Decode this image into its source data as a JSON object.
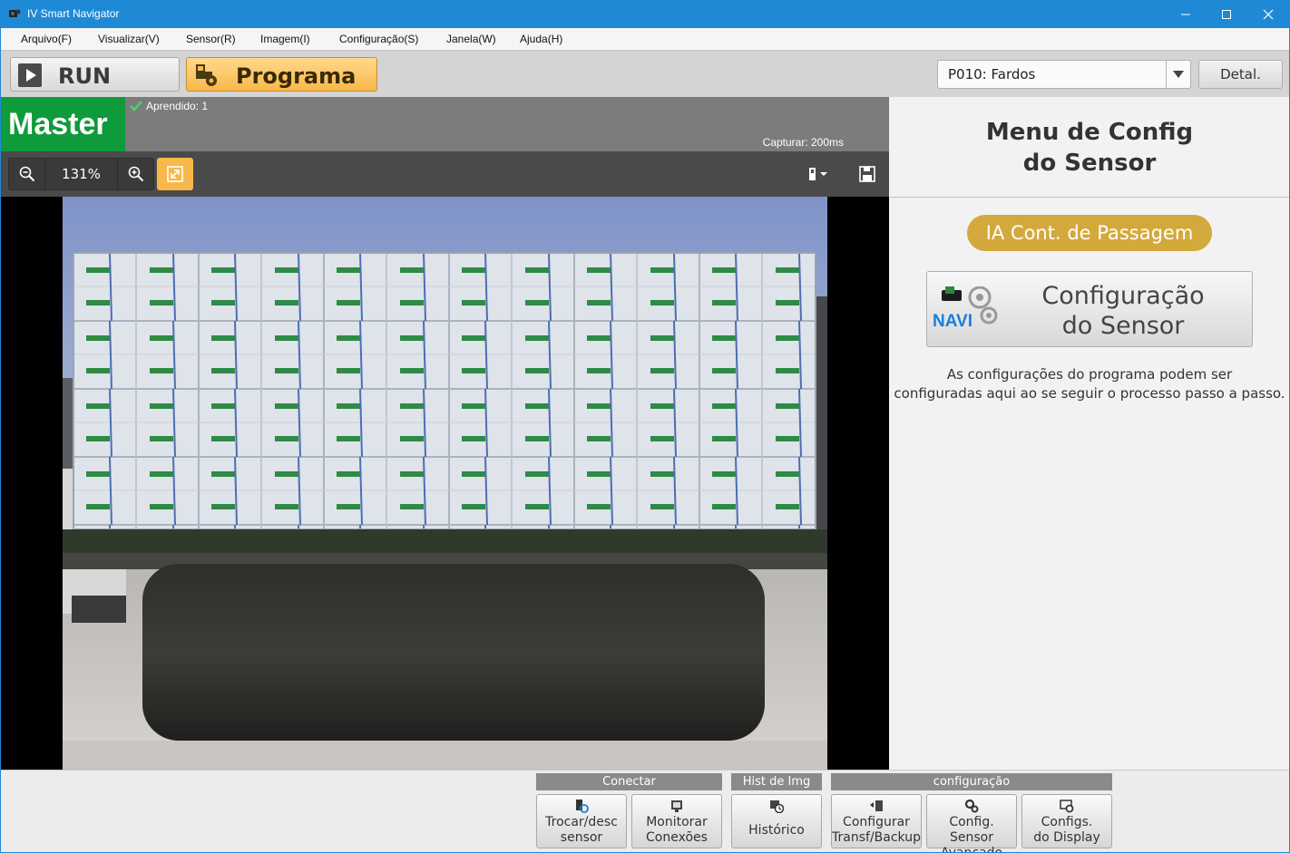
{
  "window": {
    "title": "IV Smart Navigator",
    "icons": {
      "app": "camera-icon",
      "minimize": "minimize-icon",
      "maximize": "maximize-icon",
      "close": "close-icon"
    }
  },
  "menu": {
    "items": [
      "Arquivo(F)",
      "Visualizar(V)",
      "Sensor(R)",
      "Imagem(I)",
      "Configuração(S)",
      "Janela(W)",
      "Ajuda(H)"
    ]
  },
  "toolbar": {
    "run_label": "RUN",
    "program_label": "Programa",
    "program_select": "P010: Fardos",
    "detail_label": "Detal.",
    "accent_color": "#f8b84a"
  },
  "image_panel": {
    "master_label": "Master",
    "learned_text": "Aprendido: 1",
    "capture_text": "Capturar: 200ms",
    "zoom_value": "131%",
    "master_color": "#0f9a3c"
  },
  "right_panel": {
    "title_line1": "Menu de Config",
    "title_line2": "do Sensor",
    "tool_badge": "IA Cont. de Passagem",
    "config_button_line1": "Configuração",
    "config_button_line2": "do Sensor",
    "navi_label": "NAVI",
    "description_line1": "As configurações do programa podem ser",
    "description_line2": "configuradas aqui ao se seguir o processo passo a passo."
  },
  "bottom": {
    "groups": [
      {
        "label": "Conectar"
      },
      {
        "label": "Hist de Img"
      },
      {
        "label": "configuração"
      }
    ],
    "buttons": [
      {
        "line1": "Trocar/desc",
        "line2": "sensor",
        "icon": "sensor-swap-icon"
      },
      {
        "line1": "Monitorar",
        "line2": "Conexões",
        "icon": "monitor-connections-icon"
      },
      {
        "line1": "Histórico",
        "icon": "history-icon"
      },
      {
        "line1": "Configurar",
        "line2": "Transf/Backup",
        "icon": "transfer-backup-icon"
      },
      {
        "line1": "Config. Sensor",
        "line2": "Avançado",
        "icon": "advanced-settings-icon"
      },
      {
        "line1": "Configs.",
        "line2": "do Display",
        "icon": "display-settings-icon"
      }
    ]
  }
}
